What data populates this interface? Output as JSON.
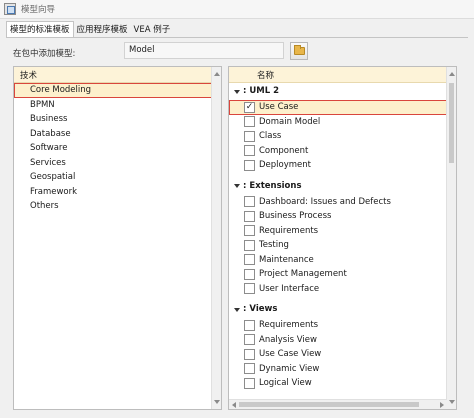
{
  "window": {
    "title": "模型向导",
    "icon": "wizard-window-icon"
  },
  "tabs": [
    {
      "label": "模型的标准模板",
      "active": true
    },
    {
      "label": "应用程序模板",
      "active": false
    },
    {
      "label": "VEA 例子",
      "active": false
    }
  ],
  "package": {
    "label": "在包中添加模型:",
    "value": "Model",
    "browse_icon": "folder-open-icon"
  },
  "technology": {
    "header": "技术",
    "items": [
      {
        "label": "Core Modeling",
        "selected": true
      },
      {
        "label": "BPMN"
      },
      {
        "label": "Business"
      },
      {
        "label": "Database"
      },
      {
        "label": "Software"
      },
      {
        "label": "Services"
      },
      {
        "label": "Geospatial"
      },
      {
        "label": "Framework"
      },
      {
        "label": "Others"
      }
    ]
  },
  "models": {
    "header": "名称",
    "groups": [
      {
        "name": "UML 2",
        "items": [
          {
            "label": "Use Case",
            "checked": true,
            "selected": true
          },
          {
            "label": "Domain Model",
            "checked": false
          },
          {
            "label": "Class",
            "checked": false
          },
          {
            "label": "Component",
            "checked": false
          },
          {
            "label": "Deployment",
            "checked": false
          }
        ]
      },
      {
        "name": "Extensions",
        "items": [
          {
            "label": "Dashboard: Issues and Defects",
            "checked": false
          },
          {
            "label": "Business Process",
            "checked": false
          },
          {
            "label": "Requirements",
            "checked": false
          },
          {
            "label": "Testing",
            "checked": false
          },
          {
            "label": "Maintenance",
            "checked": false
          },
          {
            "label": "Project Management",
            "checked": false
          },
          {
            "label": "User Interface",
            "checked": false
          }
        ]
      },
      {
        "name": "Views",
        "items": [
          {
            "label": "Requirements",
            "checked": false
          },
          {
            "label": "Analysis View",
            "checked": false
          },
          {
            "label": "Use Case View",
            "checked": false
          },
          {
            "label": "Dynamic View",
            "checked": false
          },
          {
            "label": "Logical View",
            "checked": false
          }
        ]
      }
    ]
  },
  "colors": {
    "header_bg": "#fdf3d8",
    "selection_bg": "#fdf0cc",
    "selection_border": "#d9463c"
  },
  "check_glyph": "✓",
  "group_prefix": ":"
}
